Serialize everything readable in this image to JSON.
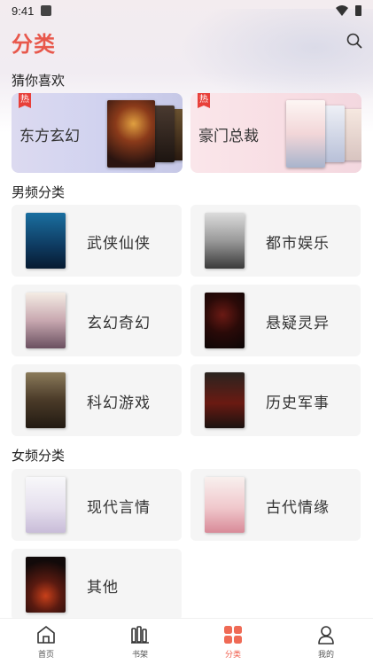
{
  "status_bar": {
    "time": "9:41"
  },
  "header": {
    "title": "分类",
    "search_icon": "search-icon",
    "accent_color": "#e8584c"
  },
  "guess_section": {
    "title": "猜你喜欢",
    "banners": [
      {
        "label": "东方玄幻",
        "tag": "热"
      },
      {
        "label": "豪门总裁",
        "tag": "热"
      }
    ]
  },
  "male_section": {
    "title": "男频分类",
    "categories": [
      {
        "label": "武侠仙侠"
      },
      {
        "label": "都市娱乐"
      },
      {
        "label": "玄幻奇幻"
      },
      {
        "label": "悬疑灵异"
      },
      {
        "label": "科幻游戏"
      },
      {
        "label": "历史军事"
      }
    ]
  },
  "female_section": {
    "title": "女频分类",
    "categories": [
      {
        "label": "现代言情"
      },
      {
        "label": "古代情缘"
      },
      {
        "label": "其他"
      }
    ]
  },
  "bottom_nav": {
    "active_color": "#ef5b4a",
    "items": [
      {
        "label": "首页",
        "icon": "home-icon"
      },
      {
        "label": "书架",
        "icon": "bookshelf-icon"
      },
      {
        "label": "分类",
        "icon": "category-icon"
      },
      {
        "label": "我的",
        "icon": "profile-icon"
      }
    ]
  }
}
